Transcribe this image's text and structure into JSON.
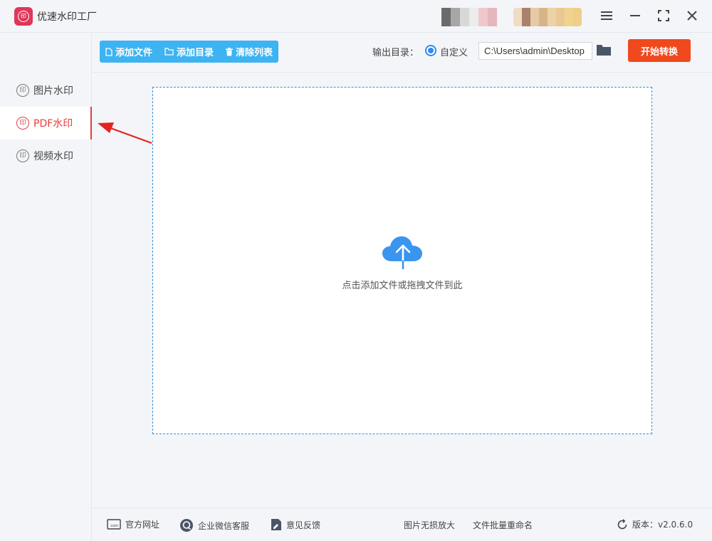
{
  "app": {
    "title": "优速水印工厂",
    "logo_text": "印"
  },
  "sidebar": {
    "items": [
      {
        "label": "图片水印",
        "icon": "seal-icon",
        "active": false
      },
      {
        "label": "PDF水印",
        "icon": "seal-icon",
        "active": true
      },
      {
        "label": "视频水印",
        "icon": "seal-icon",
        "active": false
      }
    ],
    "seal_text": "印"
  },
  "toolbar": {
    "add_file": "添加文件",
    "add_folder": "添加目录",
    "clear_list": "清除列表",
    "output_label": "输出目录：",
    "radio_label": "自定义",
    "output_path": "C:\\Users\\admin\\Desktop",
    "start_button": "开始转换"
  },
  "dropzone": {
    "hint": "点击添加文件或拖拽文件到此",
    "icon": "cloud-upload-icon"
  },
  "footer": {
    "website": "官方网址",
    "wechat_support": "企业微信客服",
    "feedback": "意见反馈",
    "lossless_enlarge": "图片无损放大",
    "batch_rename": "文件批量重命名",
    "version": "版本：v2.0.6.0"
  },
  "colors": {
    "accent_blue": "#3db3f2",
    "start_orange": "#f0491d",
    "active_red": "#e33d3d",
    "logo_pink": "#e0365a"
  }
}
